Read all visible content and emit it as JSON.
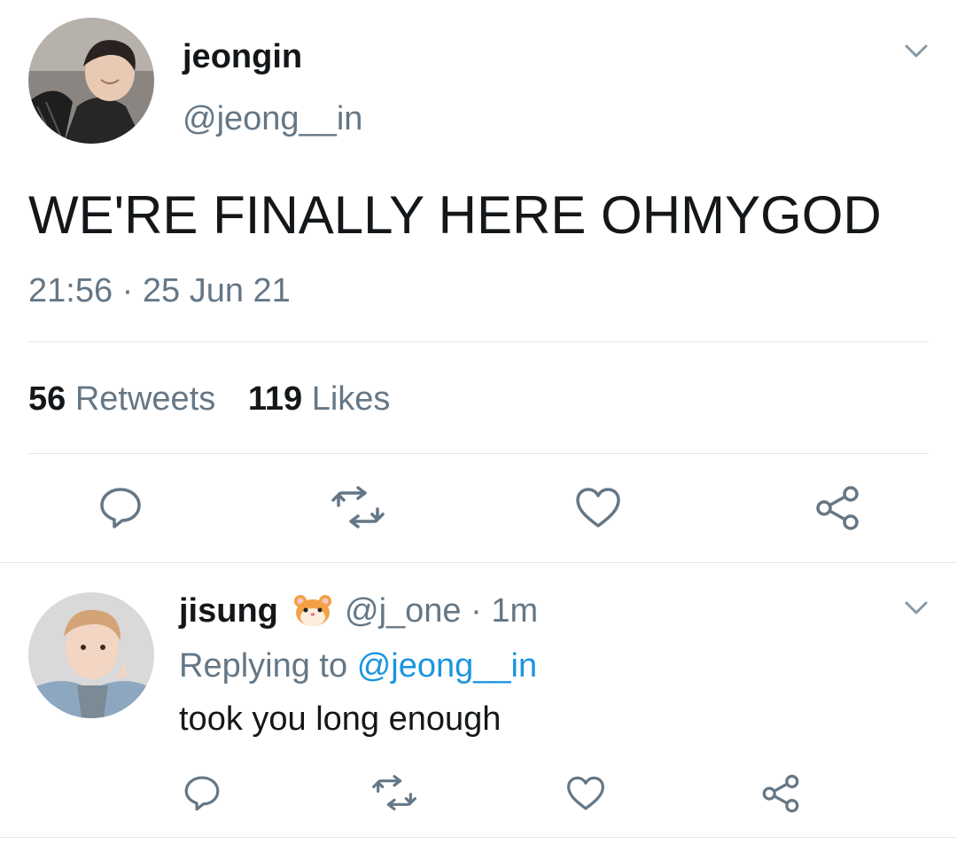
{
  "main_tweet": {
    "display_name": "jeongin",
    "handle": "@jeong__in",
    "text": "WE'RE FINALLY HERE OHMYGOD",
    "timestamp": "21:56 · 25 Jun 21",
    "retweet_count": "56",
    "retweet_label": "Retweets",
    "like_count": "119",
    "like_label": "Likes"
  },
  "reply": {
    "display_name": "jisung",
    "handle": "@j_one",
    "separator": "·",
    "time": "1m",
    "replying_prefix": "Replying to",
    "replying_to": "@jeong__in",
    "text": "took you long enough"
  },
  "icons": {
    "menu": "chevron-down-icon",
    "reply": "reply-icon",
    "retweet": "retweet-icon",
    "like": "heart-icon",
    "share": "share-icon",
    "emoji": "hamster-emoji"
  },
  "colors": {
    "text": "#14171a",
    "secondary": "#657786",
    "link": "#1b95e0",
    "divider": "#e1e8ed"
  }
}
